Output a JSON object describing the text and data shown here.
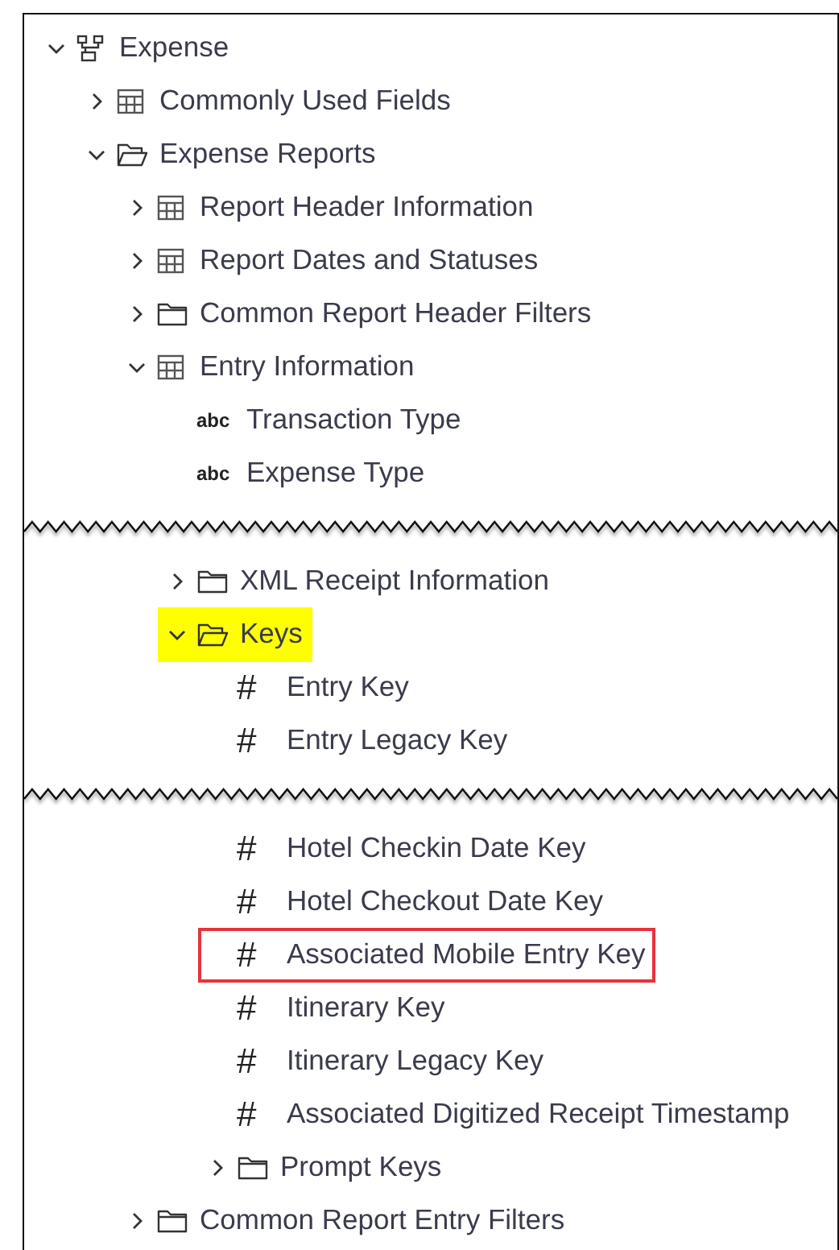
{
  "tree": [
    {
      "kind": "schema",
      "label": "Expense",
      "expanded": true,
      "children": [
        {
          "kind": "table",
          "label": "Commonly Used Fields",
          "expanded": false
        },
        {
          "kind": "folder",
          "label": "Expense Reports",
          "expanded": true,
          "children": [
            {
              "kind": "table",
              "label": "Report Header Information",
              "expanded": false
            },
            {
              "kind": "table",
              "label": "Report Dates and Statuses",
              "expanded": false
            },
            {
              "kind": "folder",
              "label": "Common Report Header Filters",
              "expanded": false
            },
            {
              "kind": "table",
              "label": "Entry Information",
              "expanded": true,
              "children": [
                {
                  "kind": "field",
                  "glyph": "abc",
                  "label": "Transaction Type"
                },
                {
                  "kind": "field",
                  "glyph": "abc",
                  "label": "Expense Type"
                },
                {
                  "kind": "tear"
                },
                {
                  "kind": "folder",
                  "label": "XML Receipt Information",
                  "expanded": false
                },
                {
                  "kind": "folder",
                  "label": "Keys",
                  "expanded": true,
                  "highlighted": true,
                  "children": [
                    {
                      "kind": "field",
                      "glyph": "#",
                      "label": "Entry Key"
                    },
                    {
                      "kind": "field",
                      "glyph": "#",
                      "label": "Entry Legacy Key"
                    },
                    {
                      "kind": "tear"
                    },
                    {
                      "kind": "field",
                      "glyph": "#",
                      "label": "Hotel Checkin Date Key"
                    },
                    {
                      "kind": "field",
                      "glyph": "#",
                      "label": "Hotel Checkout Date Key"
                    },
                    {
                      "kind": "field",
                      "glyph": "#",
                      "label": "Associated Mobile Entry Key",
                      "outlined": true
                    },
                    {
                      "kind": "field",
                      "glyph": "#",
                      "label": "Itinerary Key"
                    },
                    {
                      "kind": "field",
                      "glyph": "#",
                      "label": "Itinerary Legacy Key"
                    },
                    {
                      "kind": "field",
                      "glyph": "#",
                      "label": "Associated Digitized Receipt Timestamp"
                    },
                    {
                      "kind": "folder",
                      "label": "Prompt Keys",
                      "expanded": false
                    }
                  ]
                }
              ]
            },
            {
              "kind": "folder",
              "label": "Common Report Entry Filters",
              "expanded": false
            }
          ]
        }
      ]
    }
  ]
}
